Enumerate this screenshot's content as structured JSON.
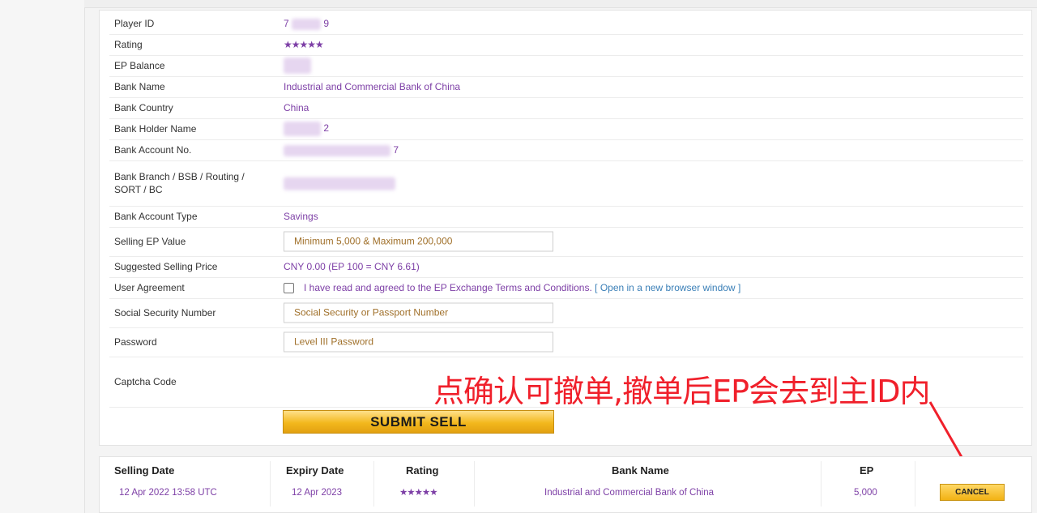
{
  "form": {
    "player_id": {
      "label": "Player ID",
      "value_start": "7",
      "value_end": "9"
    },
    "rating": {
      "label": "Rating",
      "stars": "★★★★★"
    },
    "ep_balance": {
      "label": "EP Balance"
    },
    "bank_name": {
      "label": "Bank Name",
      "value": "Industrial and Commercial Bank of China"
    },
    "bank_country": {
      "label": "Bank Country",
      "value": "China"
    },
    "bank_holder": {
      "label": "Bank Holder Name",
      "value_end": "2"
    },
    "bank_account": {
      "label": "Bank Account No.",
      "value_end": "7"
    },
    "bank_branch": {
      "label": "Bank Branch / BSB / Routing / SORT / BC"
    },
    "account_type": {
      "label": "Bank Account Type",
      "value": "Savings"
    },
    "selling_ep": {
      "label": "Selling EP Value",
      "placeholder": "Minimum 5,000 & Maximum 200,000"
    },
    "suggested_price": {
      "label": "Suggested Selling Price",
      "value": "CNY 0.00  (EP 100 = CNY 6.61)"
    },
    "user_agreement": {
      "label": "User Agreement",
      "text": "I have read and agreed to the EP Exchange Terms and Conditions.",
      "link_open": "[",
      "link": "Open in a new browser window",
      "link_close": "]"
    },
    "ssn": {
      "label": "Social Security Number",
      "placeholder": "Social Security or Passport Number"
    },
    "password": {
      "label": "Password",
      "placeholder": "Level III Password"
    },
    "captcha": {
      "label": "Captcha Code"
    },
    "submit_label": "SUBMIT SELL"
  },
  "annotation": "点确认可撤单,撤单后EP会去到主ID内",
  "table": {
    "headers": [
      "Selling Date",
      "Expiry Date",
      "Rating",
      "Bank Name",
      "EP"
    ],
    "row": {
      "selling_date": "12 Apr 2022  13:58 UTC",
      "expiry_date": "12 Apr 2023",
      "rating": "★★★★★",
      "bank_name": "Industrial and Commercial Bank of China",
      "ep": "5,000",
      "cancel_label": "CANCEL"
    }
  },
  "colors": {
    "value_text": "#7d3fa6",
    "button_gold": "#f3b81d",
    "annotation_red": "#f0202b",
    "link_blue": "#3a7fb7"
  }
}
